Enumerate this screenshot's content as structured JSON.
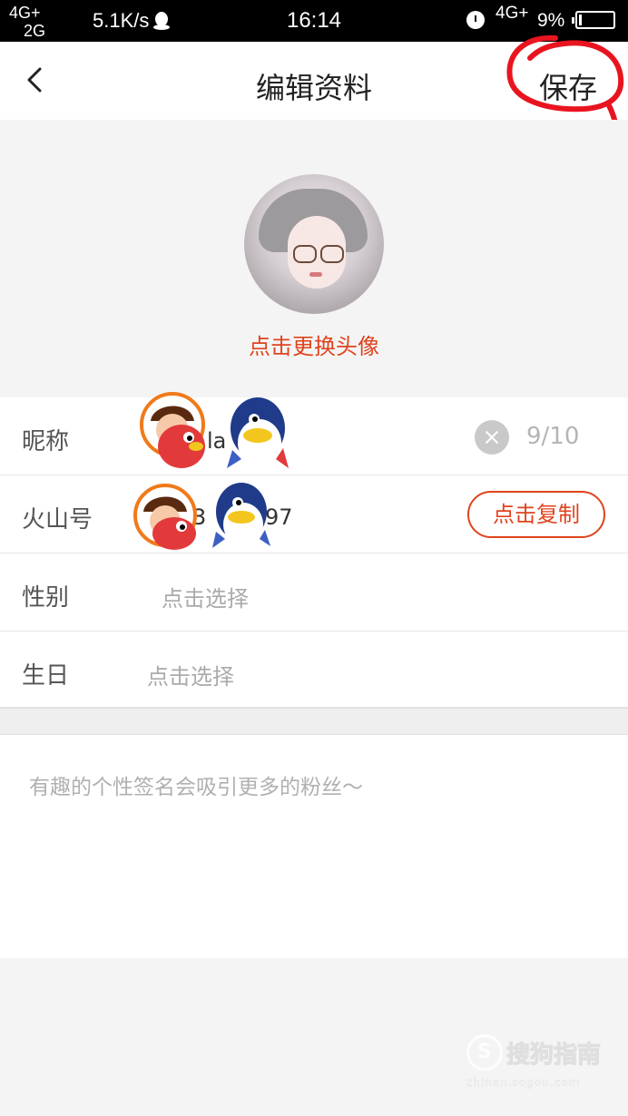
{
  "status_bar": {
    "signal_1": "4G+",
    "signal_2": "2G",
    "speed": "5.1K/s",
    "time": "16:14",
    "network": "4G+",
    "battery": "9%"
  },
  "nav": {
    "title": "编辑资料",
    "save_label": "保存",
    "highlight_color": "#e8141f"
  },
  "avatar": {
    "change_label": "点击更换头像"
  },
  "form": {
    "nickname": {
      "label": "昵称",
      "visible_fragment": "la",
      "counter": "9/10"
    },
    "huoshan_id": {
      "label": "火山号",
      "visible_fragment_a": "3",
      "visible_fragment_b": "97",
      "copy_label": "点击复制"
    },
    "gender": {
      "label": "性别",
      "placeholder": "点击选择"
    },
    "birthday": {
      "label": "生日",
      "placeholder": "点击选择"
    }
  },
  "signature": {
    "placeholder": "有趣的个性签名会吸引更多的粉丝～"
  },
  "watermark": {
    "logo": "S",
    "text": "搜狗指南",
    "sub": "zhinan.sogou.com"
  },
  "colors": {
    "accent": "#e0431d",
    "label": "#555555",
    "hint": "#aaaaaa"
  }
}
